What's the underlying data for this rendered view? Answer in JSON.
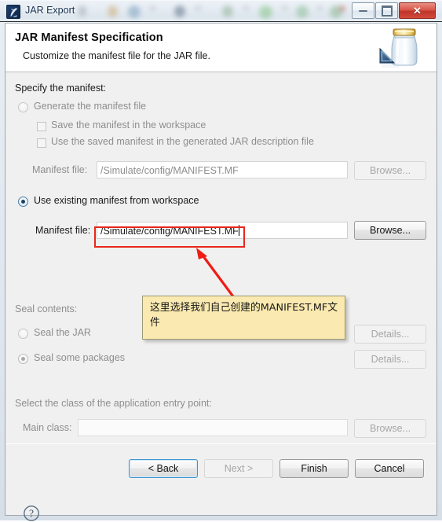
{
  "window": {
    "title": "JAR Export",
    "app_icon": "jar-export-icon",
    "controls": {
      "minimize": "minimize-button",
      "maximize": "maximize-button",
      "close_glyph": "✕"
    }
  },
  "header": {
    "title": "JAR Manifest Specification",
    "description": "Customize the manifest file for the JAR file.",
    "illustration": "jar-jar-icon"
  },
  "manifest_section": {
    "group_label": "Specify the manifest:",
    "generate": {
      "label": "Generate the manifest file",
      "selected": false,
      "enabled": false
    },
    "save_in_workspace": {
      "label": "Save the manifest in the workspace",
      "checked": false,
      "enabled": false
    },
    "use_saved_manifest": {
      "label": "Use the saved manifest in the generated JAR description file",
      "checked": false,
      "enabled": false
    },
    "generated_manifest_file": {
      "label": "Manifest file:",
      "value": "/Simulate/config/MANIFEST.MF",
      "enabled": false,
      "browse_label": "Browse..."
    },
    "use_existing": {
      "label": "Use existing manifest from workspace",
      "selected": true,
      "enabled": true
    },
    "existing_manifest_file": {
      "label": "Manifest file:",
      "value": "/Simulate/config/MANIFEST.MF",
      "enabled": true,
      "focused": true,
      "browse_label": "Browse..."
    }
  },
  "seal_section": {
    "group_label": "Seal contents:",
    "seal_jar": {
      "label": "Seal the JAR",
      "selected": false,
      "enabled": false,
      "details_label": "Details..."
    },
    "seal_packages": {
      "label": "Seal some packages",
      "selected": true,
      "enabled": false,
      "details_label": "Details..."
    }
  },
  "entry_point_section": {
    "group_label": "Select the class of the application entry point:",
    "main_class": {
      "label": "Main class:",
      "value": "",
      "placeholder": "",
      "enabled": false
    },
    "browse_label": "Browse..."
  },
  "footer": {
    "help_icon": "help-question-icon",
    "buttons": {
      "back": {
        "label": "< Back",
        "enabled": true,
        "focused": true
      },
      "next": {
        "label": "Next >",
        "enabled": false
      },
      "finish": {
        "label": "Finish",
        "enabled": true
      },
      "cancel": {
        "label": "Cancel",
        "enabled": true
      }
    }
  },
  "annotations": {
    "highlight_color": "#e8271c",
    "arrow_color": "#ee1c13",
    "callout_bg": "#fae9b0",
    "callout_text": "这里选择我们自己创建的MANIFEST.MF文件"
  }
}
